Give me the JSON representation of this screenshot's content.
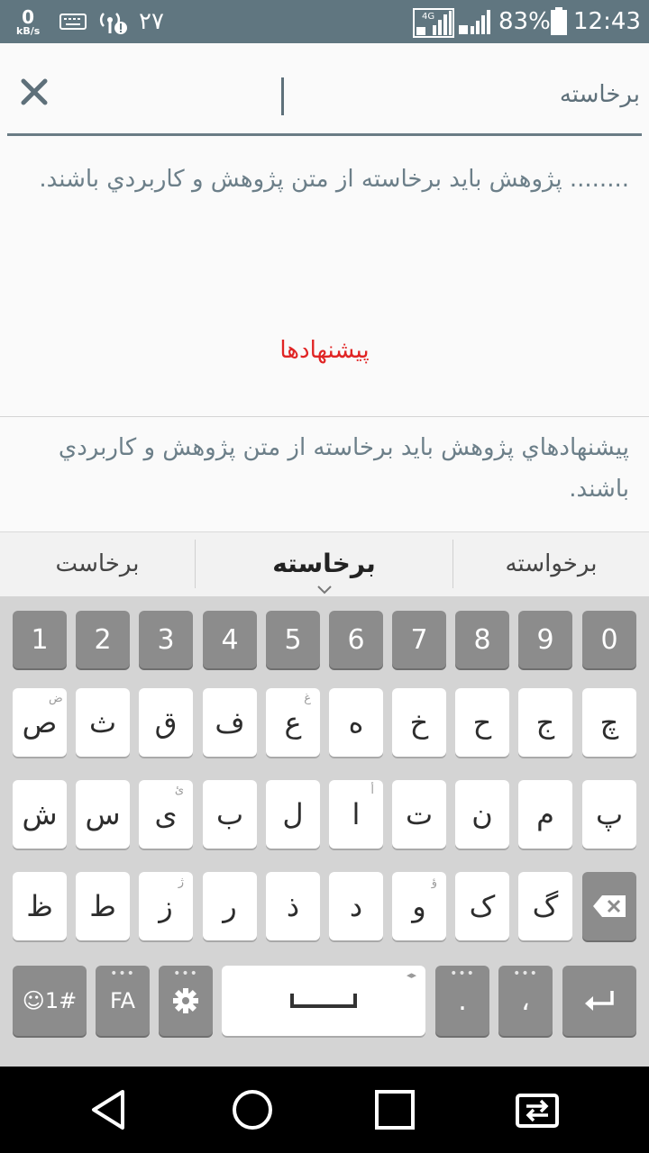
{
  "status_bar": {
    "net_speed_value": "0",
    "net_speed_unit": "kB/s",
    "notification_count": "۲۷",
    "network_type": "4G",
    "battery": "83%",
    "time": "12:43"
  },
  "search": {
    "query": "برخاسته"
  },
  "results": {
    "first_text": "........ پژوهش باید برخاسته از متن پژوهش و کاربردي باشند.",
    "heading": "پيشنهادها",
    "second_text": "پيشنهادهاي پژوهش باید برخاسته از متن پژوهش و کاربردي باشند."
  },
  "suggestions": {
    "left": "برخاست",
    "center": "برخاسته",
    "right": "برخواسته"
  },
  "keyboard": {
    "numbers": [
      "1",
      "2",
      "3",
      "4",
      "5",
      "6",
      "7",
      "8",
      "9",
      "0"
    ],
    "row1": [
      {
        "label": "ص",
        "hint": "ض"
      },
      {
        "label": "ث",
        "hint": ""
      },
      {
        "label": "ق",
        "hint": ""
      },
      {
        "label": "ف",
        "hint": ""
      },
      {
        "label": "ع",
        "hint": "غ"
      },
      {
        "label": "ه",
        "hint": ""
      },
      {
        "label": "خ",
        "hint": ""
      },
      {
        "label": "ح",
        "hint": ""
      },
      {
        "label": "ج",
        "hint": ""
      },
      {
        "label": "چ",
        "hint": ""
      }
    ],
    "row2": [
      {
        "label": "ش",
        "hint": ""
      },
      {
        "label": "س",
        "hint": ""
      },
      {
        "label": "ی",
        "hint": "ئ"
      },
      {
        "label": "ب",
        "hint": ""
      },
      {
        "label": "ل",
        "hint": ""
      },
      {
        "label": "ا",
        "hint": "أ"
      },
      {
        "label": "ت",
        "hint": ""
      },
      {
        "label": "ن",
        "hint": ""
      },
      {
        "label": "م",
        "hint": ""
      },
      {
        "label": "پ",
        "hint": ""
      }
    ],
    "row3": [
      {
        "label": "ظ",
        "hint": ""
      },
      {
        "label": "ط",
        "hint": ""
      },
      {
        "label": "ز",
        "hint": "ژ"
      },
      {
        "label": "ر",
        "hint": ""
      },
      {
        "label": "ذ",
        "hint": ""
      },
      {
        "label": "د",
        "hint": ""
      },
      {
        "label": "و",
        "hint": "ؤ"
      },
      {
        "label": "ک",
        "hint": ""
      },
      {
        "label": "گ",
        "hint": ""
      }
    ],
    "symbols_label": "☺1#",
    "language_label": "FA",
    "period_label": ".",
    "comma_label": "،",
    "more_dots": "•••",
    "space_arrows": "◂▸"
  },
  "colors": {
    "status_bar_bg": "#607680",
    "heading_red": "#e02424",
    "body_text": "#6c7f89",
    "key_gray": "#8c8c8c"
  },
  "icons": {
    "close": "close-icon",
    "settings": "gear-icon",
    "backspace": "backspace-icon",
    "enter": "enter-icon",
    "back": "back-triangle-icon",
    "home": "home-circle-icon",
    "recents": "recents-square-icon",
    "switch": "switch-apps-icon"
  }
}
